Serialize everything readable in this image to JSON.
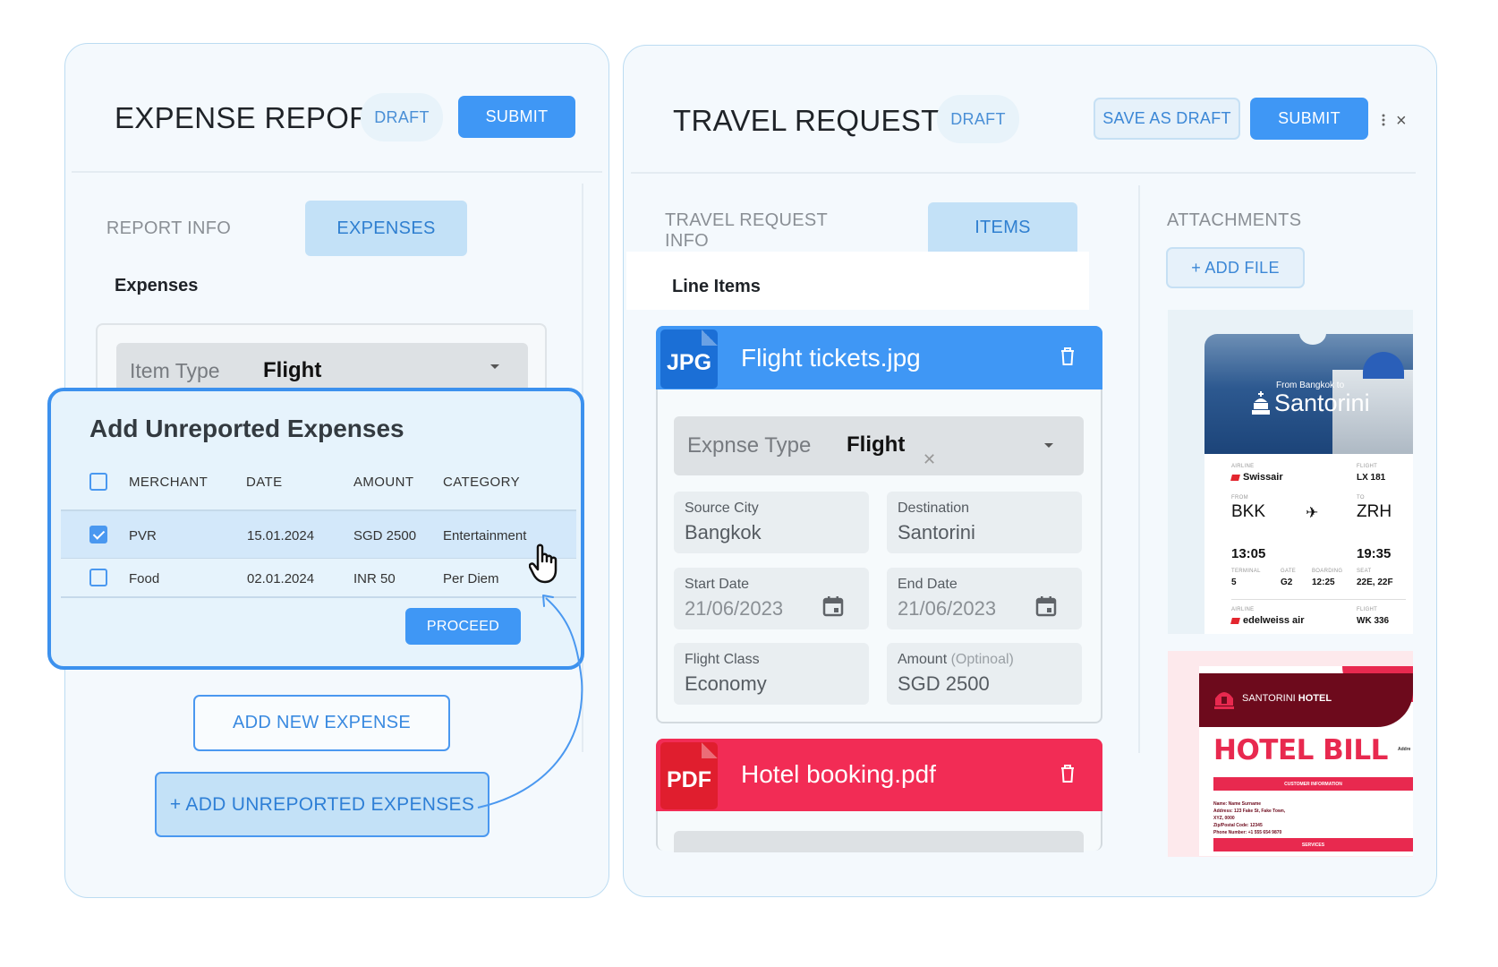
{
  "expense_report": {
    "title": "EXPENSE REPORT",
    "status": "DRAFT",
    "submit_label": "SUBMIT",
    "tabs": [
      {
        "label": "REPORT INFO",
        "active": false
      },
      {
        "label": "EXPENSES",
        "active": true
      }
    ],
    "section_label": "Expenses",
    "item_type": {
      "label": "Item Type",
      "value": "Flight"
    },
    "add_new_expense_label": "ADD NEW EXPENSE",
    "add_unreported_label": "+ ADD UNREPORTED EXPENSES"
  },
  "unreported_modal": {
    "title": "Add Unreported Expenses",
    "columns": [
      "MERCHANT",
      "DATE",
      "AMOUNT",
      "CATEGORY"
    ],
    "rows": [
      {
        "checked": true,
        "merchant": "PVR",
        "date": "15.01.2024",
        "amount": "SGD 2500",
        "category": "Entertainment"
      },
      {
        "checked": false,
        "merchant": "Food",
        "date": "02.01.2024",
        "amount": "INR 50",
        "category": "Per Diem"
      }
    ],
    "proceed_label": "PROCEED"
  },
  "travel_requests": {
    "title": "TRAVEL REQUESTS",
    "status": "DRAFT",
    "save_draft_label": "SAVE AS DRAFT",
    "submit_label": "SUBMIT",
    "tabs": [
      {
        "label": "TRAVEL REQUEST INFO",
        "active": false
      },
      {
        "label": "ITEMS",
        "active": true
      }
    ],
    "section_label": "Line Items",
    "files": [
      {
        "type": "JPG",
        "name": "Flight tickets.jpg",
        "color": "#3f97f5",
        "badge_color": "#1b6fd6"
      },
      {
        "type": "PDF",
        "name": "Hotel booking.pdf",
        "color": "#f22c55",
        "badge_color": "#e01e2e"
      }
    ],
    "expense_type": {
      "label": "Expnse Type",
      "value": "Flight"
    },
    "fields": {
      "source_city": {
        "label": "Source City",
        "value": "Bangkok"
      },
      "destination": {
        "label": "Destination",
        "value": "Santorini"
      },
      "start_date": {
        "label": "Start Date",
        "value": "21/06/2023"
      },
      "end_date": {
        "label": "End Date",
        "value": "21/06/2023"
      },
      "flight_class": {
        "label": "Flight Class",
        "value": "Economy"
      },
      "amount": {
        "label": "Amount",
        "optional": "(Optinoal)",
        "value": "SGD 2500"
      }
    }
  },
  "attachments": {
    "title": "ATTACHMENTS",
    "add_file_label": "+ ADD FILE",
    "ticket": {
      "from_text": "From Bangkok to",
      "destination": "Santorini",
      "airline_label": "AIRLINE",
      "airline": "Swissair",
      "flight_label": "FLIGHT",
      "flight": "LX 181",
      "from_label": "FROM",
      "from_code": "BKK",
      "to_label": "TO",
      "to_code": "ZRH",
      "depart_time": "13:05",
      "arrive_time": "19:35",
      "terminal_label": "TERMINAL",
      "terminal": "5",
      "gate_label": "GATE",
      "gate": "G2",
      "boarding_label": "BOARDING",
      "boarding": "12:25",
      "seat_label": "SEAT",
      "seat": "22E, 22F",
      "airline2_label": "AIRLINE",
      "airline2": "edelweiss air",
      "flight2_label": "FLIGHT",
      "flight2": "WK 336"
    },
    "hotel_bill": {
      "hotel_name_light": "SANTORINI",
      "hotel_name_bold": "HOTEL",
      "title": "HOTEL BILL",
      "address_label": "Addre",
      "customer_info": "CUSTOMER INFORMATION",
      "info_lines": [
        "Name: Name Surname",
        "Address: 123 Fake St, Fake Town,",
        "XYZ, 0000",
        "Zip/Postal Code: 12345",
        "Phone Number: +1 555 654 9870"
      ],
      "services": "SERVICES"
    }
  },
  "colors": {
    "primary": "#3f97f5",
    "accent_red": "#f22c55",
    "panel_bg": "#f4f9fd",
    "tab_active_bg": "#c3e1f7"
  }
}
